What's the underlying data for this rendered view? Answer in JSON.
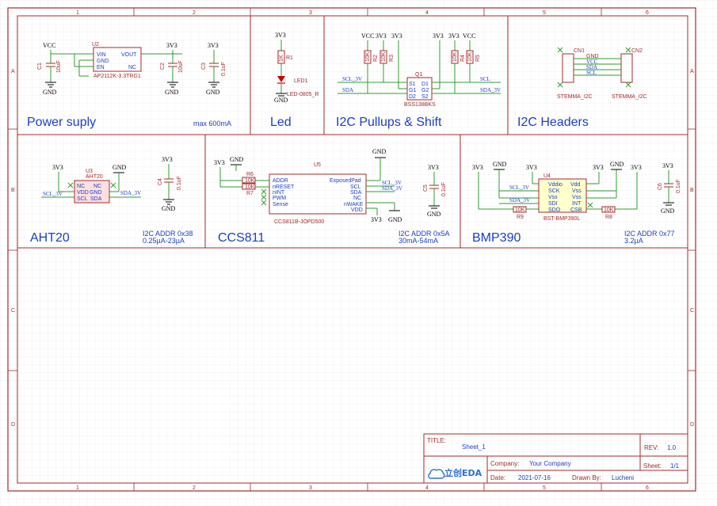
{
  "sheet": {
    "columns": [
      "1",
      "2",
      "3",
      "4",
      "5",
      "6"
    ],
    "rows": [
      "A",
      "B",
      "C",
      "D"
    ]
  },
  "sections": {
    "power": "Power suply",
    "power_note": "max 600mA",
    "led": "Led",
    "i2c_shift": "I2C Pullups & Shift",
    "i2c_headers": "I2C Headers",
    "aht20": "AHT20",
    "aht20_note1": "I2C ADDR 0x38",
    "aht20_note2": "0.25µA-23µA",
    "ccs811": "CCS811",
    "ccs811_note1": "I2C ADDR 0x5A",
    "ccs811_note2": "30mA-54mA",
    "bmp390": "BMP390",
    "bmp390_note1": "I2C ADDR 0x77",
    "bmp390_note2": "3.2µA"
  },
  "power_nets": {
    "vcc": "VCC",
    "v33": "3V3",
    "gnd": "GND"
  },
  "nets": {
    "scl_3v": "SCL_3V",
    "sda_3v": "SDA_3V",
    "scl": "SCL",
    "sda": "SDA"
  },
  "components": {
    "u2": {
      "ref": "U2",
      "part": "AP2112K-3.3TRG1",
      "pins": [
        "VIN",
        "GND",
        "EN",
        "VOUT",
        "NC"
      ]
    },
    "c1": {
      "ref": "C1",
      "value": "10uF"
    },
    "c2": {
      "ref": "C2",
      "value": "10uF"
    },
    "c3": {
      "ref": "C3",
      "value": "0.1uF"
    },
    "r1": {
      "ref": "R1",
      "value": "1K"
    },
    "led1": {
      "ref": "LED1",
      "part": "LED-0805_R"
    },
    "r2": {
      "ref": "R2",
      "value": "10K"
    },
    "r3": {
      "ref": "R3",
      "value": "10K"
    },
    "r4": {
      "ref": "R4",
      "value": "10K"
    },
    "r5": {
      "ref": "R5",
      "value": "10K"
    },
    "q1": {
      "ref": "Q1",
      "part": "BSS138BKS",
      "pins": [
        "S1",
        "G1",
        "D2",
        "D1",
        "G2",
        "S2"
      ]
    },
    "cn1": {
      "ref": "CN1",
      "part": "STEMMA_I2C"
    },
    "cn2": {
      "ref": "CN2",
      "part": "STEMMA_I2C"
    },
    "u3": {
      "ref": "U3",
      "part": "AHT20",
      "pins": [
        "NC",
        "VDD",
        "SCL",
        "NC",
        "GND",
        "SDA"
      ]
    },
    "c4": {
      "ref": "C4",
      "value": "0.1uF"
    },
    "u5": {
      "ref": "U5",
      "part": "CCS811B-JOPD500",
      "pins_left": [
        "ADDR",
        "nRESET",
        "nINT",
        "PWM",
        "Sense"
      ],
      "pins_right": [
        "ExposedPad",
        "SCL",
        "SDA",
        "NC",
        "nWAKE",
        "VDD"
      ]
    },
    "r6": {
      "ref": "R6",
      "value": "10K"
    },
    "r7": {
      "ref": "R7",
      "value": "10K"
    },
    "c5": {
      "ref": "C5",
      "value": "0.1uF"
    },
    "u4": {
      "ref": "U4",
      "part": "BST-BMP390L",
      "pins_left": [
        "Vddio",
        "SCK",
        "Vss",
        "SDI",
        "SDO"
      ],
      "pins_right": [
        "Vdd",
        "Vss",
        "Vss",
        "INT",
        "CSB"
      ]
    },
    "r9": {
      "ref": "R9",
      "value": "10K"
    },
    "r8": {
      "ref": "R8",
      "value": "10K"
    },
    "c6": {
      "ref": "C6",
      "value": "0.1uF"
    }
  },
  "header_labels": [
    "GND",
    "VCC",
    "SDA",
    "SCL"
  ],
  "title_block": {
    "title_label": "TITLE:",
    "title_value": "Sheet_1",
    "rev_label": "REV:",
    "rev_value": "1.0",
    "company_label": "Company:",
    "company_value": "Your Company",
    "sheet_label": "Sheet:",
    "sheet_value": "1/1",
    "date_label": "Date:",
    "date_value": "2021-07-16",
    "drawn_label": "Drawn By:",
    "drawn_value": "Lucheni",
    "logo_text": "立创EDA"
  },
  "colors": {
    "border": "#a52a2a",
    "text": "#1a3ec8",
    "wire": "#2e9e2e",
    "chip_fill": "#ffffcc"
  }
}
